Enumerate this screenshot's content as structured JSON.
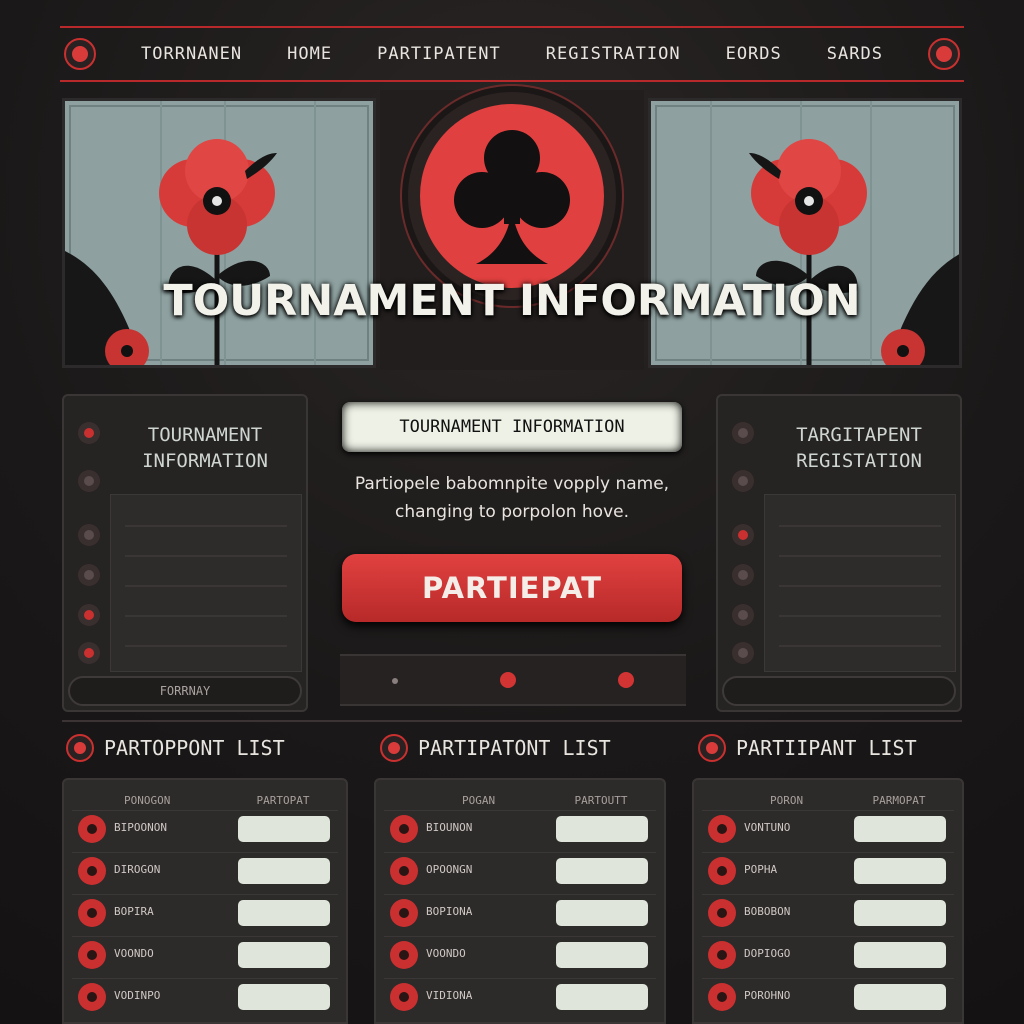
{
  "nav": {
    "items": [
      "TORRNANEN",
      "HOME",
      "PARTIPATENT",
      "REGISTRATION",
      "EORDS",
      "SARDS"
    ]
  },
  "hero": {
    "title": "TOURNAMENT INFORMATION",
    "icon": "club-suit-icon"
  },
  "left_panel": {
    "heading_line1": "TOURNAMENT",
    "heading_line2": "INFORMATION",
    "footer": "FORRNAY"
  },
  "center": {
    "pill_label": "TOURNAMENT INFORMATION",
    "text_line1": "Partiopele babomnpite vopply name,",
    "text_line2": "changing to porpolon hove.",
    "button_label": "PARTIEPAT"
  },
  "right_panel": {
    "heading_line1": "TARGITAPENT",
    "heading_line2": "REGISTATION"
  },
  "lists": [
    {
      "title": "PARTOPPONT LIST",
      "col1": "PONOGON",
      "col2": "PARTOPAT",
      "rows": [
        "BIPOONON",
        "DIROGON",
        "BOPIRA",
        "VOONDO",
        "VODINPO"
      ]
    },
    {
      "title": "PARTIPATONT LIST",
      "col1": "POGAN",
      "col2": "PARTOUTT",
      "rows": [
        "BIOUNON",
        "OPOONGN",
        "BOPIONA",
        "VOONDO",
        "VIDIONA"
      ]
    },
    {
      "title": "PARTIIPANT LIST",
      "col1": "PORON",
      "col2": "PARMOPAT",
      "rows": [
        "VONTUNO",
        "POPHA",
        "BOBOBON",
        "DOPIOGO",
        "POROHNO"
      ]
    }
  ],
  "colors": {
    "accent": "#c9302f",
    "background": "#1a1818",
    "panel": "#2d2a2a",
    "art": "#8ea1a0"
  }
}
